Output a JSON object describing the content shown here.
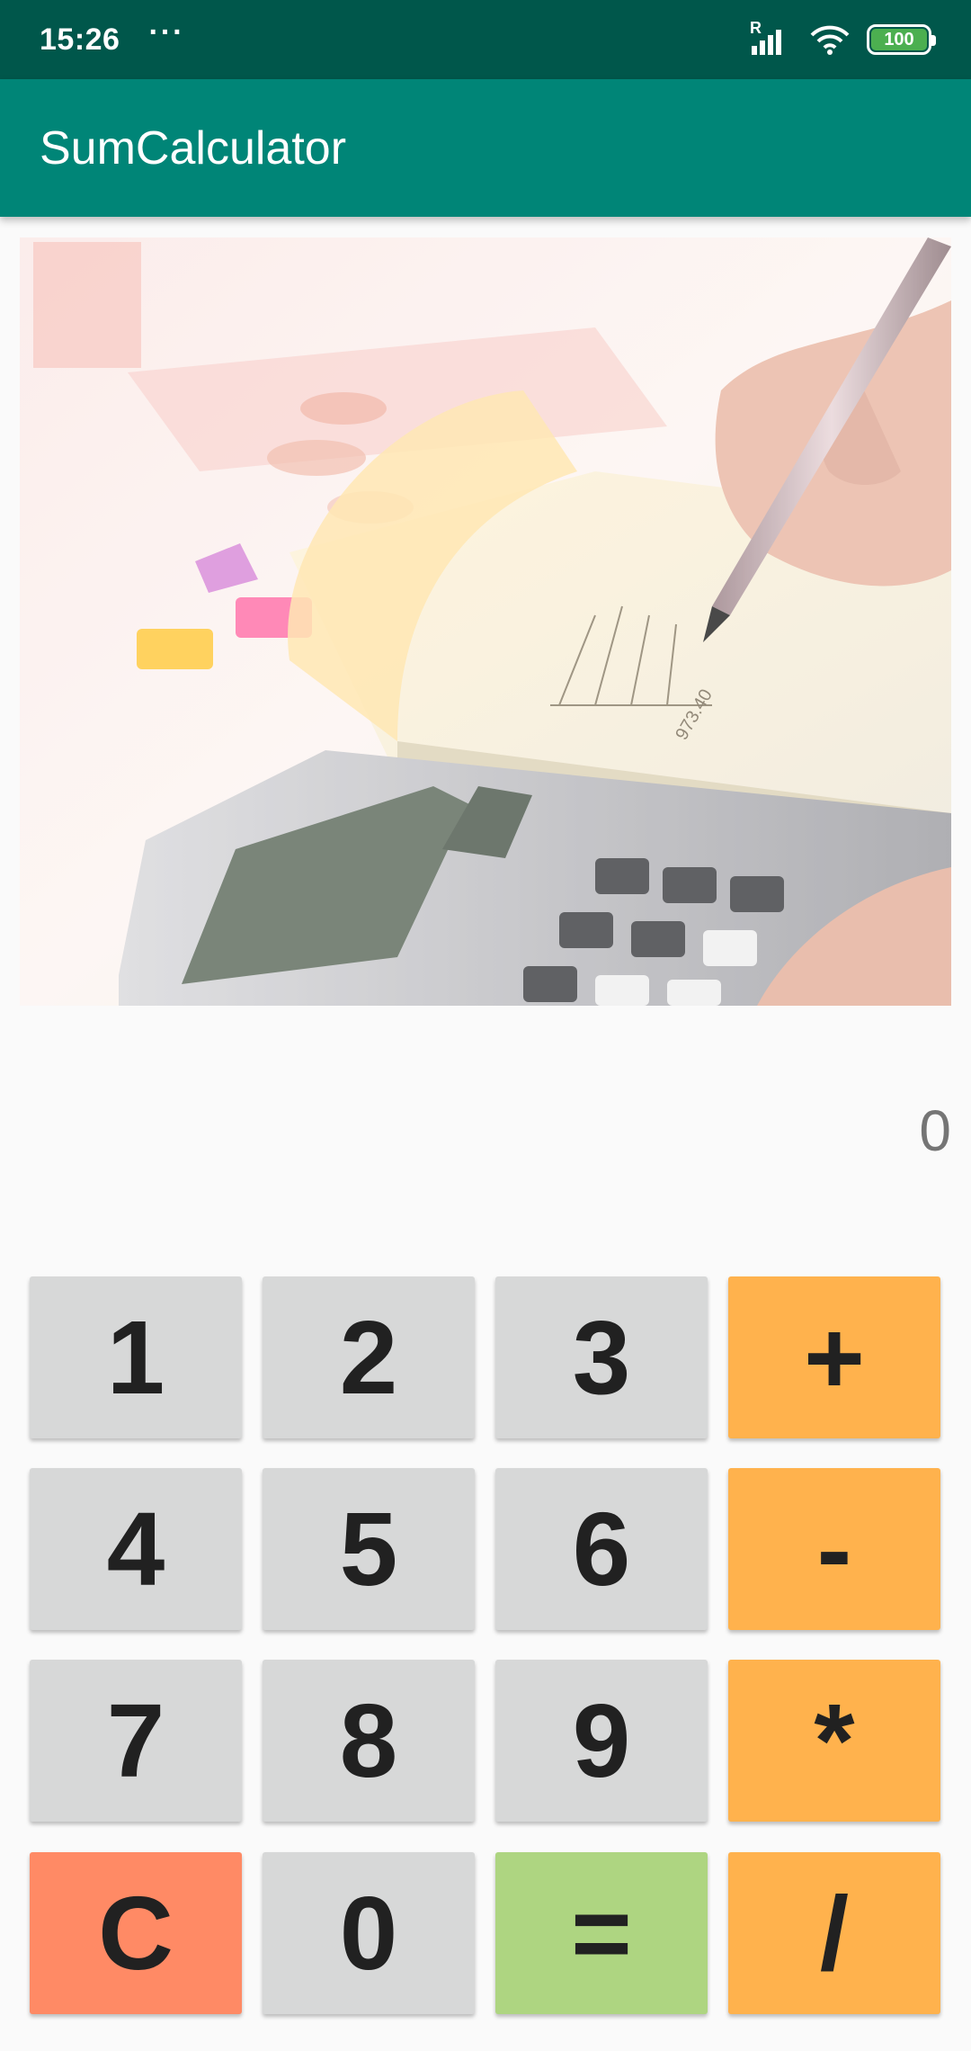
{
  "status_bar": {
    "time": "15:26",
    "overflow": "···",
    "signal_label": "R",
    "battery": "100",
    "colors": {
      "background": "#00574b",
      "battery": "#4caf50"
    }
  },
  "app_bar": {
    "title": "SumCalculator",
    "color": "#008577"
  },
  "hero_image": {
    "icon": "calculator-photo",
    "notes_text": "973.40"
  },
  "display": {
    "value": "0"
  },
  "keypad": {
    "row1": [
      "1",
      "2",
      "3",
      "+"
    ],
    "row2": [
      "4",
      "5",
      "6",
      "-"
    ],
    "row3": [
      "7",
      "8",
      "9",
      "*"
    ],
    "row4": [
      "C",
      "0",
      "=",
      "/"
    ],
    "colors": {
      "number": "#d7d8d8",
      "operator": "#ffb24d",
      "clear": "#ff8a65",
      "equals": "#aed581"
    }
  }
}
